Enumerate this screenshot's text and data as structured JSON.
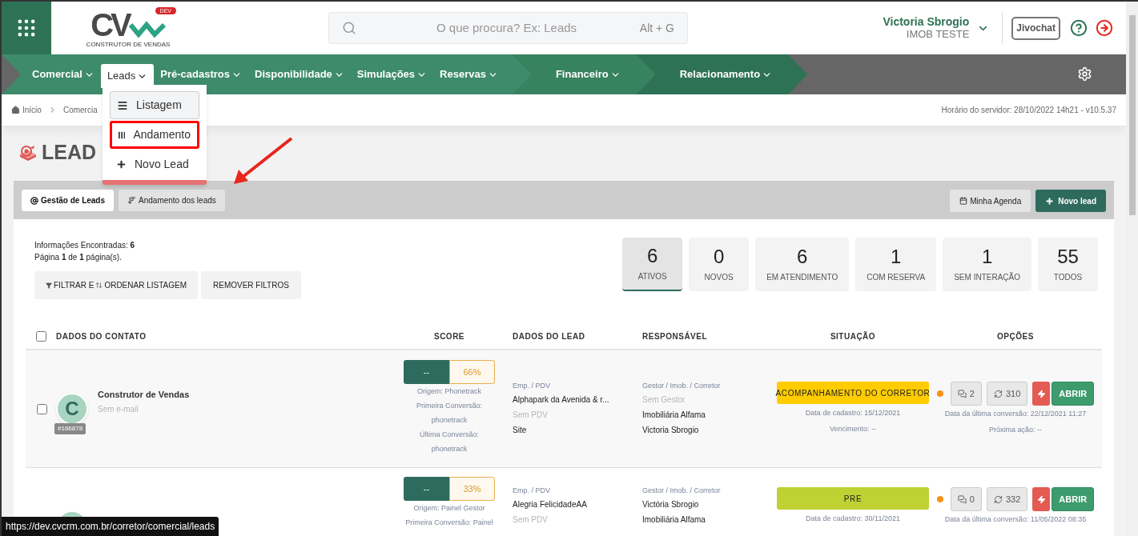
{
  "header": {
    "logo": {
      "letters": "CV",
      "badge": "DEV",
      "tagline": "CONSTRUTOR DE VENDAS"
    },
    "search": {
      "placeholder": "O que procura? Ex: Leads",
      "shortcut": "Alt + G"
    },
    "user": {
      "name": "Victoria Sbrogio",
      "company": "IMOB TESTE"
    },
    "chat_button": "Jivochat"
  },
  "nav": {
    "groups": [
      {
        "items": [
          {
            "label": "Comercial",
            "selected": false
          },
          {
            "label": "Leads",
            "selected": true
          },
          {
            "label": "Pré-cadastros",
            "selected": false
          },
          {
            "label": "Disponibilidade",
            "selected": false
          },
          {
            "label": "Simulações",
            "selected": false
          },
          {
            "label": "Reservas",
            "selected": false
          }
        ]
      },
      {
        "items": [
          {
            "label": "Financeiro",
            "selected": false
          }
        ]
      },
      {
        "items": [
          {
            "label": "Relacionamento",
            "selected": false
          }
        ]
      }
    ]
  },
  "dropdown": {
    "items": [
      {
        "label": "Listagem",
        "kind": "list",
        "selected": true,
        "highlighted": false
      },
      {
        "label": "Andamento",
        "kind": "columns",
        "selected": false,
        "highlighted": true
      },
      {
        "label": "Novo Lead",
        "kind": "plus",
        "selected": false,
        "highlighted": false
      }
    ]
  },
  "breadcrumb": [
    "Início",
    "Comercia"
  ],
  "server_time": "Horário do servidor: 28/10/2022 14h21 - v10.5.37",
  "page_title": "LEAD",
  "tabs": [
    {
      "label": "Gestão de Leads",
      "kind": "at",
      "selected": true
    },
    {
      "label": "Andamento dos leads",
      "kind": "sort",
      "selected": false
    }
  ],
  "actions": [
    {
      "label": "Minha Agenda",
      "kind": "calendar"
    },
    {
      "label": "Novo lead",
      "kind": "add"
    }
  ],
  "info": [
    "Informações Encontradas: **6**",
    "Página **1** de **1** página(s)."
  ],
  "filter_button": {
    "before": "FILTRAR E",
    "after": "ORDENAR LISTAGEM"
  },
  "clear_button": "REMOVER FILTROS",
  "stats": [
    {
      "count": "6",
      "label": "ATIVOS",
      "selected": true
    },
    {
      "count": "0",
      "label": "NOVOS",
      "selected": false
    },
    {
      "count": "6",
      "label": "EM ATENDIMENTO",
      "selected": false
    },
    {
      "count": "1",
      "label": "COM RESERVA",
      "selected": false
    },
    {
      "count": "1",
      "label": "SEM INTERAÇÃO",
      "selected": false
    },
    {
      "count": "55",
      "label": "TODOS",
      "selected": false
    }
  ],
  "table": {
    "all_checked": false,
    "columns": [
      "DADOS DO CONTATO",
      "SCORE",
      "DADOS DO LEAD",
      "RESPONSÁVEL",
      "SITUAÇÃO",
      "OPÇÕES"
    ],
    "rows": [
      {
        "checked": false,
        "avatar": "C",
        "name": "Construtor de Vendas",
        "email": "Sem e-mail",
        "id": "#166878",
        "score": "--",
        "percent": "66%",
        "score_notes": [
          "Origem: Phonetrack",
          "Primeira Conversão:",
          "phonetrack",
          "Última Conversão:",
          "phonetrack"
        ],
        "lead_lines": [
          {
            "text": "Emp. / PDV",
            "kind": "label"
          },
          {
            "text": "Alphapark da Avenida & r...",
            "kind": "value"
          },
          {
            "text": "Sem PDV",
            "kind": "empty"
          },
          {
            "text": "Site",
            "kind": "value"
          }
        ],
        "resp_lines": [
          {
            "text": "Gestor / Imob. / Corretor",
            "kind": "label"
          },
          {
            "text": "Sem Gestor",
            "kind": "empty"
          },
          {
            "text": "Imobiliária Alfama",
            "kind": "value"
          },
          {
            "text": "Victoria Sbrogio",
            "kind": "value"
          }
        ],
        "status": {
          "label": "ACOMPANHAMENTO DO CORRETOR",
          "color": "#ffcc00"
        },
        "status_notes": [
          "Data de cadastro: 15/12/2021",
          "Vencimento: --"
        ],
        "dot": {
          "color": "#f7931e"
        },
        "messages": "2",
        "sync": "310",
        "open": "ABRIR",
        "option_notes": [
          "Data da última conversão: 22/12/2021 11:27",
          "Próxima ação: --"
        ]
      },
      {
        "score": "--",
        "percent": "33%",
        "score_notes": [
          "Origem: Painel Gestor",
          "Primeira Conversão: Painel"
        ],
        "lead_lines": [
          {
            "text": "Emp. / PDV",
            "kind": "label"
          },
          {
            "text": "Alegria FelicidadeAA",
            "kind": "value"
          },
          {
            "text": "Sem PDV",
            "kind": "empty"
          }
        ],
        "resp_lines": [
          {
            "text": "Gestor / Imob. / Corretor",
            "kind": "label"
          },
          {
            "text": "Victória Sbrogio",
            "kind": "value"
          },
          {
            "text": "Imobiliária Alfama",
            "kind": "value"
          }
        ],
        "status": {
          "label": "PRE",
          "color": "#bfd133"
        },
        "status_notes": [
          "Data de cadastro: 30/11/2021"
        ],
        "dot": {
          "color": "#f7931e"
        },
        "messages": "0",
        "sync": "332",
        "open": "ABRIR",
        "option_notes": [
          "Data da última conversão: 11/05/2022 08:35"
        ]
      }
    ]
  },
  "status_url": "https://dev.cvcrm.com.br/corretor/comercial/leads"
}
